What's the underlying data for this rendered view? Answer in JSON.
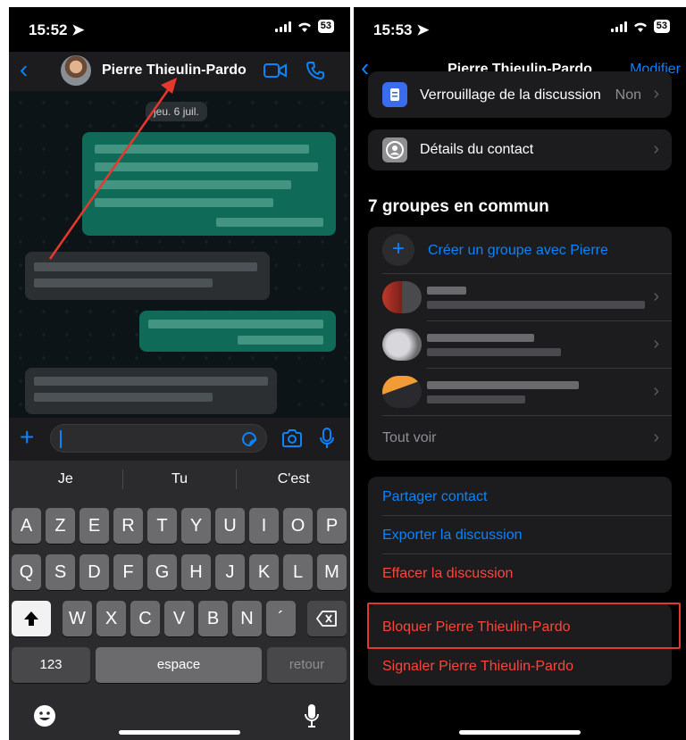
{
  "left": {
    "status": {
      "time": "15:52",
      "battery": "53"
    },
    "header": {
      "contact_name": "Pierre Thieulin-Pardo"
    },
    "chat": {
      "date_label": "jeu. 6 juil."
    },
    "keyboard": {
      "suggestions": [
        "Je",
        "Tu",
        "C'est"
      ],
      "row1": [
        "A",
        "Z",
        "E",
        "R",
        "T",
        "Y",
        "U",
        "I",
        "O",
        "P"
      ],
      "row2": [
        "Q",
        "S",
        "D",
        "F",
        "G",
        "H",
        "J",
        "K",
        "L",
        "M"
      ],
      "row3": [
        "W",
        "X",
        "C",
        "V",
        "B",
        "N",
        "´"
      ],
      "numbers_key": "123",
      "space_key": "espace",
      "return_key": "retour"
    }
  },
  "right": {
    "status": {
      "time": "15:53",
      "battery": "53"
    },
    "header": {
      "contact_name": "Pierre Thieulin-Pardo",
      "edit_label": "Modifier"
    },
    "lock_row": {
      "label": "Verrouillage de la discussion",
      "value": "Non"
    },
    "contact_details_label": "Détails du contact",
    "groups": {
      "title": "7 groupes en commun",
      "create_label": "Créer un groupe avec Pierre",
      "see_all_label": "Tout voir"
    },
    "actions": {
      "share": "Partager contact",
      "export": "Exporter la discussion",
      "clear": "Effacer la discussion",
      "block": "Bloquer Pierre Thieulin-Pardo",
      "report": "Signaler Pierre Thieulin-Pardo"
    }
  },
  "colors": {
    "accent": "#0a84ff",
    "danger": "#ff453a",
    "highlight": "#e03a2e",
    "annotation_arrow": "#e8372c"
  },
  "icons": [
    "location-arrow-icon",
    "signal-icon",
    "wifi-icon",
    "battery-icon",
    "back-chevron-icon",
    "video-call-icon",
    "phone-call-icon",
    "plus-icon",
    "sticker-icon",
    "camera-icon",
    "microphone-icon",
    "shift-icon",
    "backspace-icon",
    "emoji-icon",
    "lock-icon",
    "contact-icon",
    "chevron-right-icon"
  ]
}
